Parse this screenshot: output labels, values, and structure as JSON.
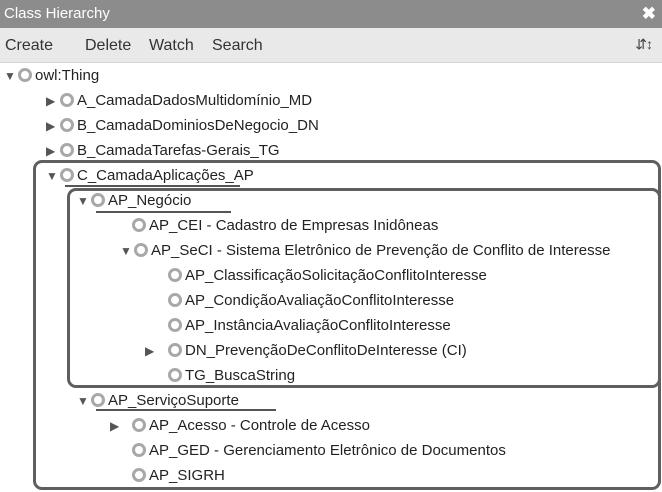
{
  "window": {
    "title": "Class Hierarchy",
    "close_icon": "close-icon"
  },
  "toolbar": {
    "create": "Create",
    "delete": "Delete",
    "watch": "Watch",
    "search": "Search",
    "sort_icon": "sort-icon"
  },
  "tree": {
    "root": "owl:Thing",
    "a": "A_CamadaDadosMultidomínio_MD",
    "b_dn": "B_CamadaDominiosDeNegocio_DN",
    "b_tg": "B_CamadaTarefas-Gerais_TG",
    "c": "C_CamadaAplicações_AP",
    "ap_negocio": "AP_Negócio",
    "ap_cei": "AP_CEI",
    "ap_cei_desc": " - Cadastro de Empresas Inidôneas",
    "ap_seci": "AP_SeCI",
    "ap_seci_desc": " - Sistema Eletrônico de Prevenção de Conflito de Interesse",
    "ap_classif": "AP_ClassificaçãoSolicitaçãoConflitoInteresse",
    "ap_condicao": "AP_CondiçãoAvaliaçãoConflitoInteresse",
    "ap_instancia": "AP_InstânciaAvaliaçãoConflitoInteresse",
    "dn_prevencao": "DN_PrevençãoDeConflitoDeInteresse (CI)",
    "tg_busca": "TG_BuscaString",
    "ap_servico": "AP_ServiçoSuporte",
    "ap_acesso": "AP_Acesso",
    "ap_acesso_desc": " - Controle de Acesso",
    "ap_ged": "AP_GED",
    "ap_ged_desc": " - Gerenciamento Eletrônico de Documentos",
    "ap_sigrh": "AP_SIGRH"
  }
}
